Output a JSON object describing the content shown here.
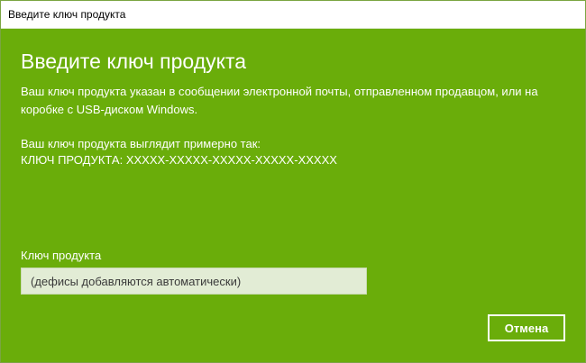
{
  "window": {
    "title": "Введите ключ продукта"
  },
  "main": {
    "heading": "Введите ключ продукта",
    "description": "Ваш ключ продукта указан в сообщении электронной почты, отправленном продавцом, или на коробке с USB-диском Windows.",
    "example_intro": "Ваш ключ продукта выглядит примерно так:",
    "example_key": "КЛЮЧ ПРОДУКТА: XXXXX-XXXXX-XXXXX-XXXXX-XXXXX"
  },
  "form": {
    "field_label": "Ключ продукта",
    "value": "",
    "placeholder": "(дефисы добавляются автоматически)"
  },
  "buttons": {
    "cancel": "Отмена"
  },
  "colors": {
    "accent": "#6aad0a",
    "titlebar": "#ffffff",
    "input_background": "#e2ecd5"
  }
}
